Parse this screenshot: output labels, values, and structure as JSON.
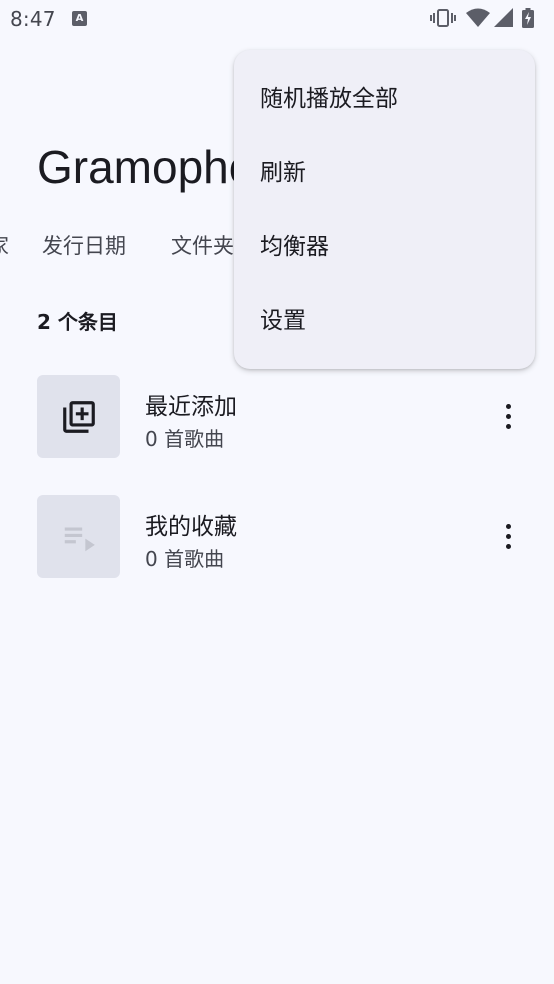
{
  "status_bar": {
    "time": "8:47",
    "notification_icon_letter": "A",
    "icons": [
      "vibrate-icon",
      "wifi-icon",
      "signal-icon",
      "battery-charging-icon"
    ]
  },
  "header": {
    "title": "Gramophone"
  },
  "tabs": [
    {
      "label": "家"
    },
    {
      "label": "发行日期"
    },
    {
      "label": "文件夹"
    }
  ],
  "list": {
    "count_label": "2 个条目",
    "items": [
      {
        "title": "最近添加",
        "subtitle": "0 首歌曲",
        "icon": "library-add-icon"
      },
      {
        "title": "我的收藏",
        "subtitle": "0 首歌曲",
        "icon": "playlist-play-icon"
      }
    ]
  },
  "overflow_menu": {
    "items": [
      {
        "label": "随机播放全部"
      },
      {
        "label": "刷新"
      },
      {
        "label": "均衡器"
      },
      {
        "label": "设置"
      }
    ]
  },
  "colors": {
    "background": "#f7f8fe",
    "menu_background": "#efeff7",
    "thumbnail": "#e0e2ec",
    "text_primary": "#1b1b21",
    "text_secondary": "#44464f"
  }
}
